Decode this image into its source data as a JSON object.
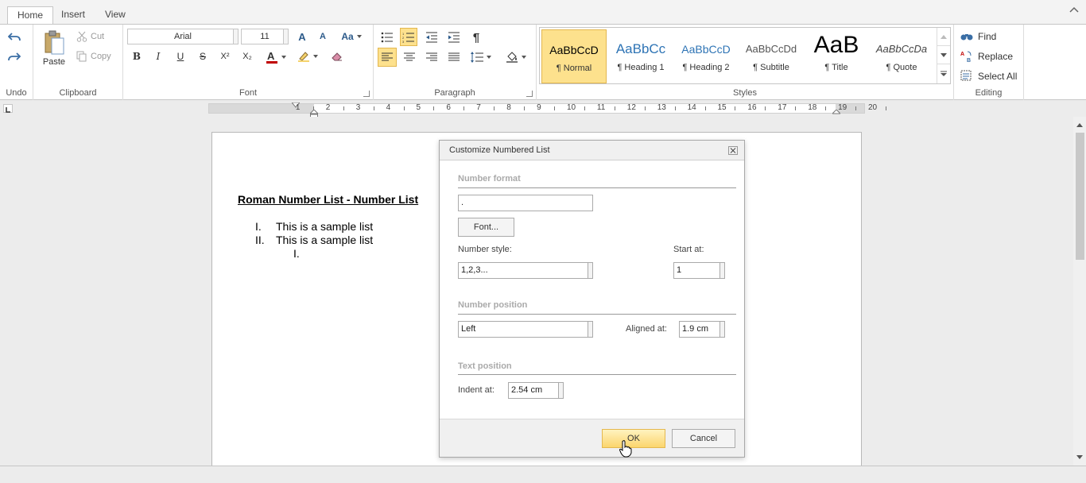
{
  "tabs": [
    {
      "label": "Home"
    },
    {
      "label": "Insert"
    },
    {
      "label": "View"
    }
  ],
  "ribbon": {
    "undo_group": "Undo",
    "clipboard": {
      "label": "Clipboard",
      "paste": "Paste",
      "cut": "Cut",
      "copy": "Copy"
    },
    "font": {
      "label": "Font",
      "family": "Arial",
      "size": "11"
    },
    "paragraph": {
      "label": "Paragraph"
    },
    "styles": {
      "label": "Styles",
      "items": [
        {
          "preview": "AaBbCcD",
          "name": "¶ Normal"
        },
        {
          "preview": "AaBbCc",
          "name": "¶ Heading 1"
        },
        {
          "preview": "AaBbCcD",
          "name": "¶ Heading 2"
        },
        {
          "preview": "AaBbCcDd",
          "name": "¶ Subtitle"
        },
        {
          "preview": "AaB",
          "name": "¶ Title"
        },
        {
          "preview": "AaBbCcDa",
          "name": "¶ Quote"
        }
      ]
    },
    "editing": {
      "label": "Editing",
      "find": "Find",
      "replace": "Replace",
      "select_all": "Select All"
    }
  },
  "ruler": {
    "numbers": [
      "1",
      "2",
      "3",
      "4",
      "5",
      "6",
      "7",
      "8",
      "9",
      "10",
      "11",
      "12",
      "13",
      "14",
      "15",
      "16",
      "17",
      "18",
      "19",
      "20"
    ]
  },
  "document": {
    "title": "Roman Number List - Number List",
    "items": [
      {
        "marker": "I.",
        "text": "This is a sample list"
      },
      {
        "marker": "II.",
        "text": "This is a sample list"
      },
      {
        "marker": "I.",
        "text": ""
      }
    ]
  },
  "dialog": {
    "title": "Customize Numbered List",
    "number_format_section": "Number format",
    "number_format_value": ".",
    "font_button": "Font...",
    "number_style_label": "Number style:",
    "number_style_value": "1,2,3...",
    "start_at_label": "Start at:",
    "start_at_value": "1",
    "number_position_section": "Number position",
    "position_value": "Left",
    "aligned_at_label": "Aligned at:",
    "aligned_at_value": "1.9 cm",
    "text_position_section": "Text position",
    "indent_at_label": "Indent at:",
    "indent_at_value": "2.54 cm",
    "ok": "OK",
    "cancel": "Cancel"
  },
  "colors": {
    "accent": "#fde18d",
    "accent_border": "#e3b74f",
    "heading_blue": "#2e74b5",
    "font_red": "#c00000"
  }
}
